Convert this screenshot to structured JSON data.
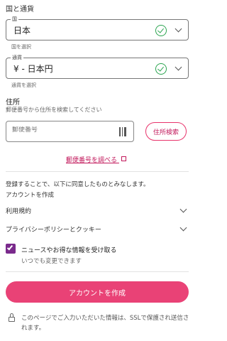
{
  "country": {
    "section_label": "国と通貨",
    "legend": "国",
    "value": "日本",
    "helper": "国を選択"
  },
  "currency": {
    "legend": "通貨",
    "value": "¥ - 日本円",
    "helper": "通貨を選択"
  },
  "address": {
    "title": "住所",
    "description": "郵便番号から住所を検索してください",
    "postal_placeholder": "郵便番号",
    "search_button": "住所検索",
    "lookup_link": "郵便番号を調べる"
  },
  "agreement": {
    "intro": "登録することで、以下に同意したものとみなします。",
    "subtitle": "アカウントを作成",
    "terms": "利用規約",
    "privacy": "プライバシーポリシーとクッキー"
  },
  "newsletter": {
    "label": "ニュースやお得な情報を受け取る",
    "sublabel": "いつでも変更できます",
    "checked": true
  },
  "submit_label": "アカウントを作成",
  "security_note": "このページでご入力いただいた情報は、SSLで保護され送信されます。",
  "colors": {
    "accent": "#e8336b",
    "check_green": "#2aa44f",
    "checkbox": "#7a2a8c"
  }
}
